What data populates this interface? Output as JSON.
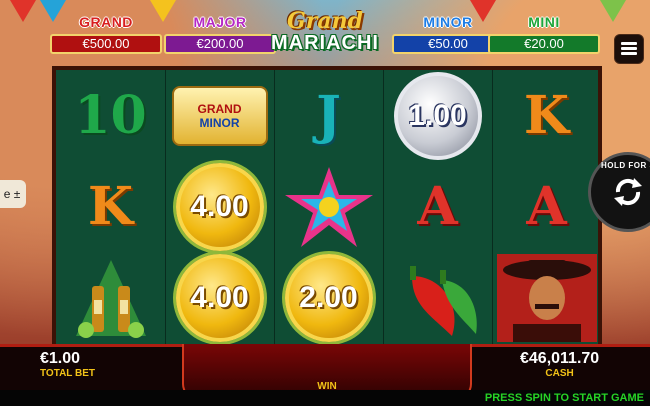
{
  "jackpots": [
    {
      "name": "GRAND",
      "amount": "€500.00",
      "name_color": "#d81e1e",
      "box_color": "#b01010"
    },
    {
      "name": "MAJOR",
      "amount": "€200.00",
      "name_color": "#b629c6",
      "box_color": "#7d1a92"
    },
    {
      "name": "MINOR",
      "amount": "€50.00",
      "name_color": "#1d7de6",
      "box_color": "#1342a8"
    },
    {
      "name": "MINI",
      "amount": "€20.00",
      "name_color": "#1ea63a",
      "box_color": "#137a2a"
    }
  ],
  "logo": {
    "line1": "Grand",
    "line2": "MARIACHI"
  },
  "reels": [
    [
      {
        "kind": "letter",
        "text": "10",
        "color": "#1fa84a",
        "icon": "ten-symbol-icon"
      },
      {
        "kind": "letter",
        "text": "K",
        "color": "#f08a1a",
        "icon": "king-symbol-icon"
      },
      {
        "kind": "picture",
        "icon": "beer-bottles-icon"
      }
    ],
    [
      {
        "kind": "banner",
        "lines": [
          "GRAND",
          "MINOR"
        ],
        "icon": "jackpot-banner-icon"
      },
      {
        "kind": "coin",
        "text": "4.00",
        "icon": "gold-coin-icon"
      },
      {
        "kind": "coin",
        "text": "4.00",
        "icon": "gold-coin-icon"
      }
    ],
    [
      {
        "kind": "letter",
        "text": "J",
        "color": "#19b3b8",
        "icon": "jack-symbol-icon"
      },
      {
        "kind": "picture",
        "icon": "pinata-star-icon"
      },
      {
        "kind": "coin",
        "text": "2.00",
        "icon": "gold-coin-icon"
      }
    ],
    [
      {
        "kind": "coin-silver",
        "text": "1.00",
        "icon": "silver-coin-icon"
      },
      {
        "kind": "letter",
        "text": "A",
        "color": "#e0332a",
        "icon": "ace-symbol-icon"
      },
      {
        "kind": "picture",
        "icon": "chili-peppers-icon"
      }
    ],
    [
      {
        "kind": "letter",
        "text": "K",
        "color": "#f08a1a",
        "icon": "king-symbol-icon"
      },
      {
        "kind": "letter",
        "text": "A",
        "color": "#e0332a",
        "icon": "ace-symbol-icon"
      },
      {
        "kind": "picture",
        "icon": "mariachi-singer-icon"
      }
    ]
  ],
  "hold_button": {
    "label": "HOLD FOR SE"
  },
  "side_button": {
    "label": "e ±"
  },
  "footer": {
    "total_bet_value": "€1.00",
    "total_bet_label": "TOTAL BET",
    "win_label": "WIN",
    "cash_value": "€46,011.70",
    "cash_label": "CASH",
    "prompt": "PRESS SPIN TO START GAME"
  }
}
